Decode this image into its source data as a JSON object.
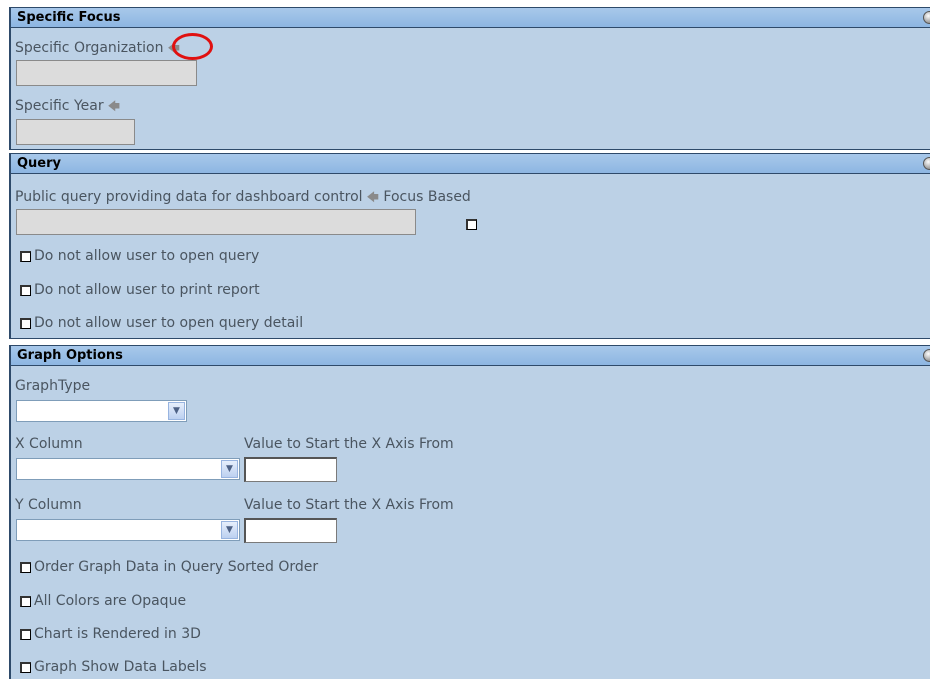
{
  "specific_focus": {
    "title": "Specific Focus",
    "org_label": "Specific Organization",
    "year_label": "Specific Year"
  },
  "query": {
    "title": "Query",
    "public_query_label": "Public query providing data for dashboard control",
    "focus_based_label": "Focus Based",
    "checkboxes": [
      "Do not allow user to open query",
      "Do not allow user to print report",
      "Do not allow user to open query detail"
    ]
  },
  "graph_options": {
    "title": "Graph Options",
    "graph_type_label": "GraphType",
    "x_column_label": "X Column",
    "x_start_label": "Value to Start the X Axis From",
    "y_column_label": "Y Column",
    "y_start_label": "Value to Start the X Axis From",
    "checkboxes": [
      "Order Graph Data in Query Sorted Order",
      "All Colors are Opaque",
      "Chart is Rendered in 3D",
      "Graph Show Data Labels"
    ]
  },
  "icons": {
    "arrow": "arrow-left-icon",
    "collapse": "collapse-icon",
    "dropdown": "chevron-down-icon"
  },
  "colors": {
    "panel_bg": "#bcd1e6",
    "header_bg": "#8db6e2",
    "annotation": "#e01010"
  }
}
